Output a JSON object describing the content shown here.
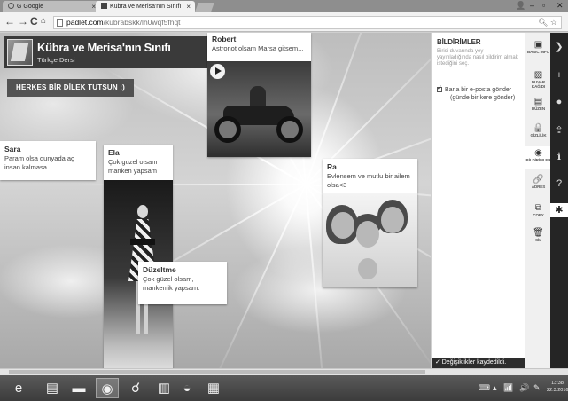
{
  "browser": {
    "tabs": [
      {
        "label": "G Google",
        "active": false
      },
      {
        "label": "Kübra ve Merisa'nın Sınıfı",
        "active": true
      }
    ],
    "tab_close": "×",
    "url_host": "padlet.com",
    "url_path": "/kubrabskk/lh0wqf5fhqt",
    "icons": [
      "back-icon",
      "forward-icon",
      "reload-icon",
      "home-icon",
      "page-icon",
      "search-icon",
      "star-icon"
    ]
  },
  "wall": {
    "title": "Kübra ve Merisa'nın Sınıfı",
    "subtitle": "Türkçe Dersi",
    "heading": "HERKES BİR DİLEK TUTSUN :)"
  },
  "posts": {
    "robert": {
      "author": "Robert",
      "text": "Astronot olsam Marsa gitsem..."
    },
    "sara": {
      "author": "Sara",
      "text": "Param olsa dunyada aç insan kalmasa..."
    },
    "ela": {
      "author": "Ela",
      "text": "Çok guzel olsam manken yapsam"
    },
    "duzeltme": {
      "author": "Düzeltme",
      "text": "Çok güzel olsam, mankenlik yapsam."
    },
    "ra": {
      "author": "Ra",
      "text": "Evlensem ve mutlu bir ailem olsa<3"
    }
  },
  "settings": {
    "title": "BİLDİRİMLER",
    "description": "Birisi duvarında yey yayınladığında nasıl bildirim almak istediğini seç.",
    "email_option": "Bana bir e-posta gönder",
    "email_option_sub": "(günde bir kere gönder)",
    "email_checked": true,
    "saved_message": "✓ Değişiklikler kaydedildi."
  },
  "rail": {
    "items": [
      {
        "label": "BASIC INFO",
        "icon": "▣",
        "icon_name": "basic-info-icon"
      },
      {
        "label": "DUVAR KAĞIDI",
        "icon": "▨",
        "icon_name": "wallpaper-icon"
      },
      {
        "label": "DÜZEN",
        "icon": "▤",
        "icon_name": "layout-icon"
      },
      {
        "label": "GİZLİLİK",
        "icon": "🔒",
        "icon_name": "lock-icon"
      },
      {
        "label": "BİLDİRİMLER",
        "icon": "◉",
        "icon_name": "eye-icon"
      },
      {
        "label": "ADRES",
        "icon": "🔗",
        "icon_name": "link-icon"
      },
      {
        "label": "COPY",
        "icon": "⧉",
        "icon_name": "copy-icon"
      },
      {
        "label": "SİL",
        "icon": "🗑",
        "icon_name": "trash-icon"
      }
    ]
  },
  "darkbar": {
    "icons": [
      {
        "name": "padlet-logo-icon",
        "glyph": "❯"
      },
      {
        "name": "add-icon",
        "glyph": "+"
      },
      {
        "name": "user-icon",
        "glyph": "●"
      },
      {
        "name": "share-icon",
        "glyph": "⇪"
      },
      {
        "name": "info-icon",
        "glyph": "ℹ"
      },
      {
        "name": "help-icon",
        "glyph": "?"
      },
      {
        "name": "settings-gear-icon",
        "glyph": "✱"
      }
    ]
  },
  "taskbar": {
    "items": [
      {
        "name": "ie-icon",
        "glyph": "e"
      },
      {
        "name": "file-explorer-icon",
        "glyph": "▤"
      },
      {
        "name": "display-icon",
        "glyph": "▬"
      },
      {
        "name": "chrome-icon",
        "glyph": "◉"
      },
      {
        "name": "tool-icon",
        "glyph": "☌"
      },
      {
        "name": "library-icon",
        "glyph": "▥"
      },
      {
        "name": "media-icon",
        "glyph": "◒"
      },
      {
        "name": "app-icon",
        "glyph": "▦"
      }
    ],
    "time": "13:38",
    "date": "22.3.2016"
  }
}
